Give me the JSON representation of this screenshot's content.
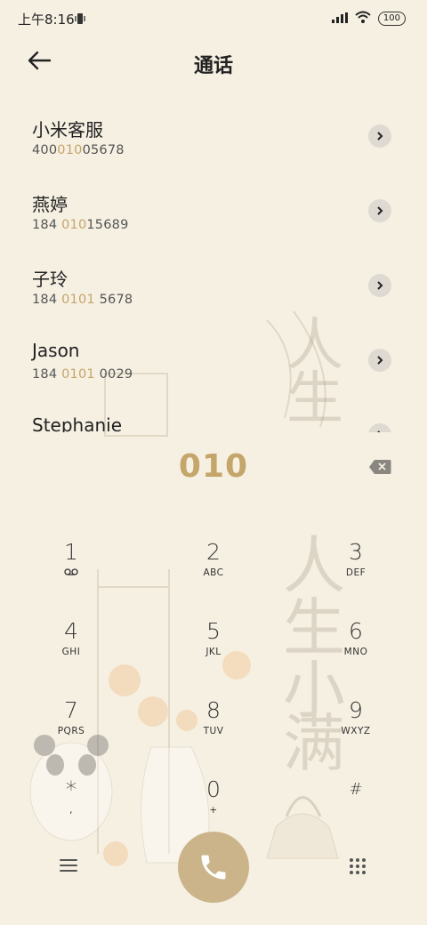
{
  "status_bar": {
    "time": "上午8:16",
    "battery": "100"
  },
  "header": {
    "title": "通话"
  },
  "contacts": [
    {
      "name": "小米客服",
      "num_pre": "400",
      "num_hl": "010",
      "num_post": "05678"
    },
    {
      "name": "燕婷",
      "num_pre": "184 ",
      "num_hl": "010",
      "num_post": "15689"
    },
    {
      "name": "子玲",
      "num_pre": "184 ",
      "num_hl": "0101",
      "num_post": " 5678"
    },
    {
      "name": "Jason",
      "num_pre": "184 ",
      "num_hl": "0101",
      "num_post": " 0029"
    },
    {
      "name": "Stephanie",
      "num_pre": "",
      "num_hl": "",
      "num_post": ""
    }
  ],
  "dialer": {
    "input_value": "010"
  },
  "keypad": [
    {
      "digit": "1",
      "letters": ""
    },
    {
      "digit": "2",
      "letters": "ABC"
    },
    {
      "digit": "3",
      "letters": "DEF"
    },
    {
      "digit": "4",
      "letters": "GHI"
    },
    {
      "digit": "5",
      "letters": "JKL"
    },
    {
      "digit": "6",
      "letters": "MNO"
    },
    {
      "digit": "7",
      "letters": "PQRS"
    },
    {
      "digit": "8",
      "letters": "TUV"
    },
    {
      "digit": "9",
      "letters": "WXYZ"
    },
    {
      "digit": "*",
      "letters": ","
    },
    {
      "digit": "0",
      "letters": "+"
    },
    {
      "digit": "#",
      "letters": ""
    }
  ],
  "icons": {
    "vibrate": "vibrate-icon",
    "signal": "signal-icon",
    "wifi": "wifi-icon",
    "back": "back-arrow-icon",
    "chevron": "chevron-right-icon",
    "backspace": "backspace-icon",
    "voicemail": "voicemail-icon",
    "menu": "menu-icon",
    "call": "phone-icon",
    "keypad": "keypad-grid-icon"
  },
  "colors": {
    "background": "#f6f0e2",
    "accent": "#c4a56a",
    "call_button": "#cbb48a"
  }
}
